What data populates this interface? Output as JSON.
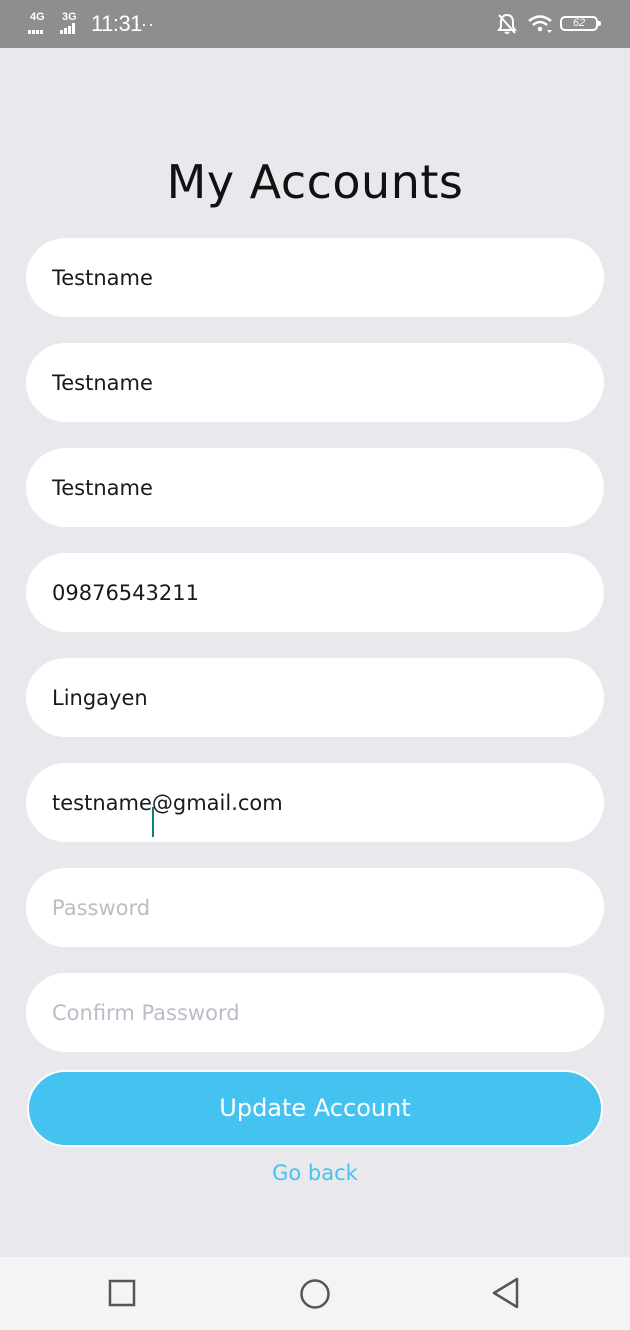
{
  "status_bar": {
    "network_1": "4G",
    "network_2": "3G",
    "time": "11:31",
    "more": "···",
    "battery": "62"
  },
  "page": {
    "title": "My Accounts"
  },
  "form": {
    "fields": [
      {
        "name": "first-name-field",
        "value": "Testname",
        "placeholder": ""
      },
      {
        "name": "middle-name-field",
        "value": "Testname",
        "placeholder": ""
      },
      {
        "name": "last-name-field",
        "value": "Testname",
        "placeholder": ""
      },
      {
        "name": "phone-field",
        "value": "09876543211",
        "placeholder": ""
      },
      {
        "name": "address-field",
        "value": "Lingayen",
        "placeholder": ""
      },
      {
        "name": "email-field",
        "value_before_cursor": "testname",
        "value_after_cursor": "@gmail.com",
        "placeholder": ""
      },
      {
        "name": "password-field",
        "value": "",
        "placeholder": "Password"
      },
      {
        "name": "confirm-password-field",
        "value": "",
        "placeholder": "Confirm Password"
      }
    ],
    "update_label": "Update Account",
    "go_back_label": "Go back"
  },
  "colors": {
    "accent": "#44c3f1",
    "background": "#e8e8ed",
    "caret": "#0d7f80",
    "status_bar": "#8e8e8e"
  },
  "icons": {
    "status": [
      "signal-icon",
      "signal-icon",
      "bell-off-icon",
      "wifi-icon",
      "battery-icon"
    ],
    "nav": [
      "recent-apps-icon",
      "home-icon",
      "back-icon"
    ]
  }
}
